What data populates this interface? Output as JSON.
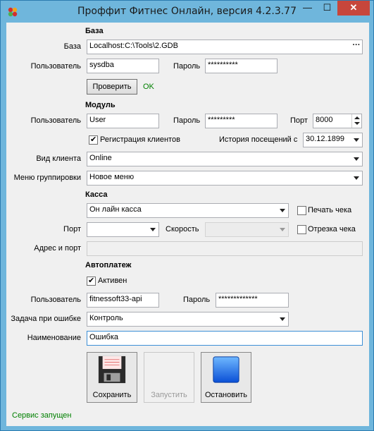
{
  "window": {
    "title": "Проффит Фитнес Онлайн, версия 4.2.3.77",
    "min_label": "—",
    "max_label": "☐",
    "close_label": "✕"
  },
  "db": {
    "header": "База",
    "base_label": "База",
    "base_value": "Localhost:C:\\Tools\\2.GDB",
    "browse_label": "···",
    "user_label": "Пользователь",
    "user_value": "sysdba",
    "password_label": "Пароль",
    "password_value": "**********",
    "check_button": "Проверить",
    "check_status": "OK"
  },
  "module": {
    "header": "Модуль",
    "user_label": "Пользователь",
    "user_value": "User",
    "password_label": "Пароль",
    "password_value": "*********",
    "port_label": "Порт",
    "port_value": "8000",
    "reg_label": "Регистрация клиентов",
    "history_label": "История посещений с",
    "history_value": "30.12.1899",
    "client_view_label": "Вид клиента",
    "client_view_value": "Online",
    "group_menu_label": "Меню группировки",
    "group_menu_value": "Новое меню"
  },
  "kassa": {
    "header": "Касса",
    "type_value": "Он лайн касса",
    "print_label": "Печать чека",
    "port_label": "Порт",
    "speed_label": "Скорость",
    "cut_label": "Отрезка чека",
    "address_label": "Адрес и порт"
  },
  "autopay": {
    "header": "Автоплатеж",
    "active_label": "Активен",
    "user_label": "Пользователь",
    "user_value": "fitnessoft33-api",
    "password_label": "Пароль",
    "password_value": "*************",
    "error_task_label": "Задача при ошибке",
    "error_task_value": "Контроль",
    "name_label": "Наименование",
    "name_value": "Ошибка"
  },
  "actions": {
    "save": "Сохранить",
    "start": "Запустить",
    "stop": "Остановить"
  },
  "status": "Сервис запущен"
}
